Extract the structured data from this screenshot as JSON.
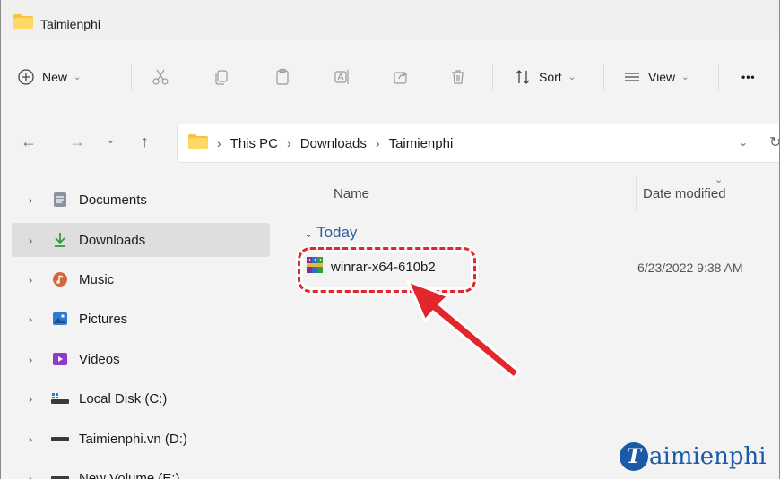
{
  "window": {
    "title": "Taimienphi"
  },
  "toolbar": {
    "new_label": "New",
    "sort_label": "Sort",
    "view_label": "View",
    "more_label": "•••"
  },
  "address": {
    "crumbs": [
      "This PC",
      "Downloads",
      "Taimienphi"
    ]
  },
  "sidebar": {
    "items": [
      {
        "label": "Documents",
        "icon": "documents-icon",
        "selected": false
      },
      {
        "label": "Downloads",
        "icon": "download-icon",
        "selected": true
      },
      {
        "label": "Music",
        "icon": "music-icon",
        "selected": false
      },
      {
        "label": "Pictures",
        "icon": "pictures-icon",
        "selected": false
      },
      {
        "label": "Videos",
        "icon": "videos-icon",
        "selected": false
      },
      {
        "label": "Local Disk (C:)",
        "icon": "local-disk-icon",
        "selected": false
      },
      {
        "label": "Taimienphi.vn (D:)",
        "icon": "drive-icon",
        "selected": false
      },
      {
        "label": "New Volume (E:)",
        "icon": "drive-icon",
        "selected": false
      }
    ]
  },
  "filelist": {
    "header_name": "Name",
    "header_date": "Date modified",
    "group": "Today",
    "files": [
      {
        "name": "winrar-x64-610b2",
        "date": "6/23/2022 9:38 AM",
        "icon": "winrar-icon"
      }
    ]
  },
  "watermark": {
    "text": "aimienphi",
    "logo_letter": "T"
  },
  "colors": {
    "highlight": "#e3252c",
    "arrow": "#e3252c",
    "accent": "#2c5e9e",
    "watermark": "#1a5aa8"
  }
}
